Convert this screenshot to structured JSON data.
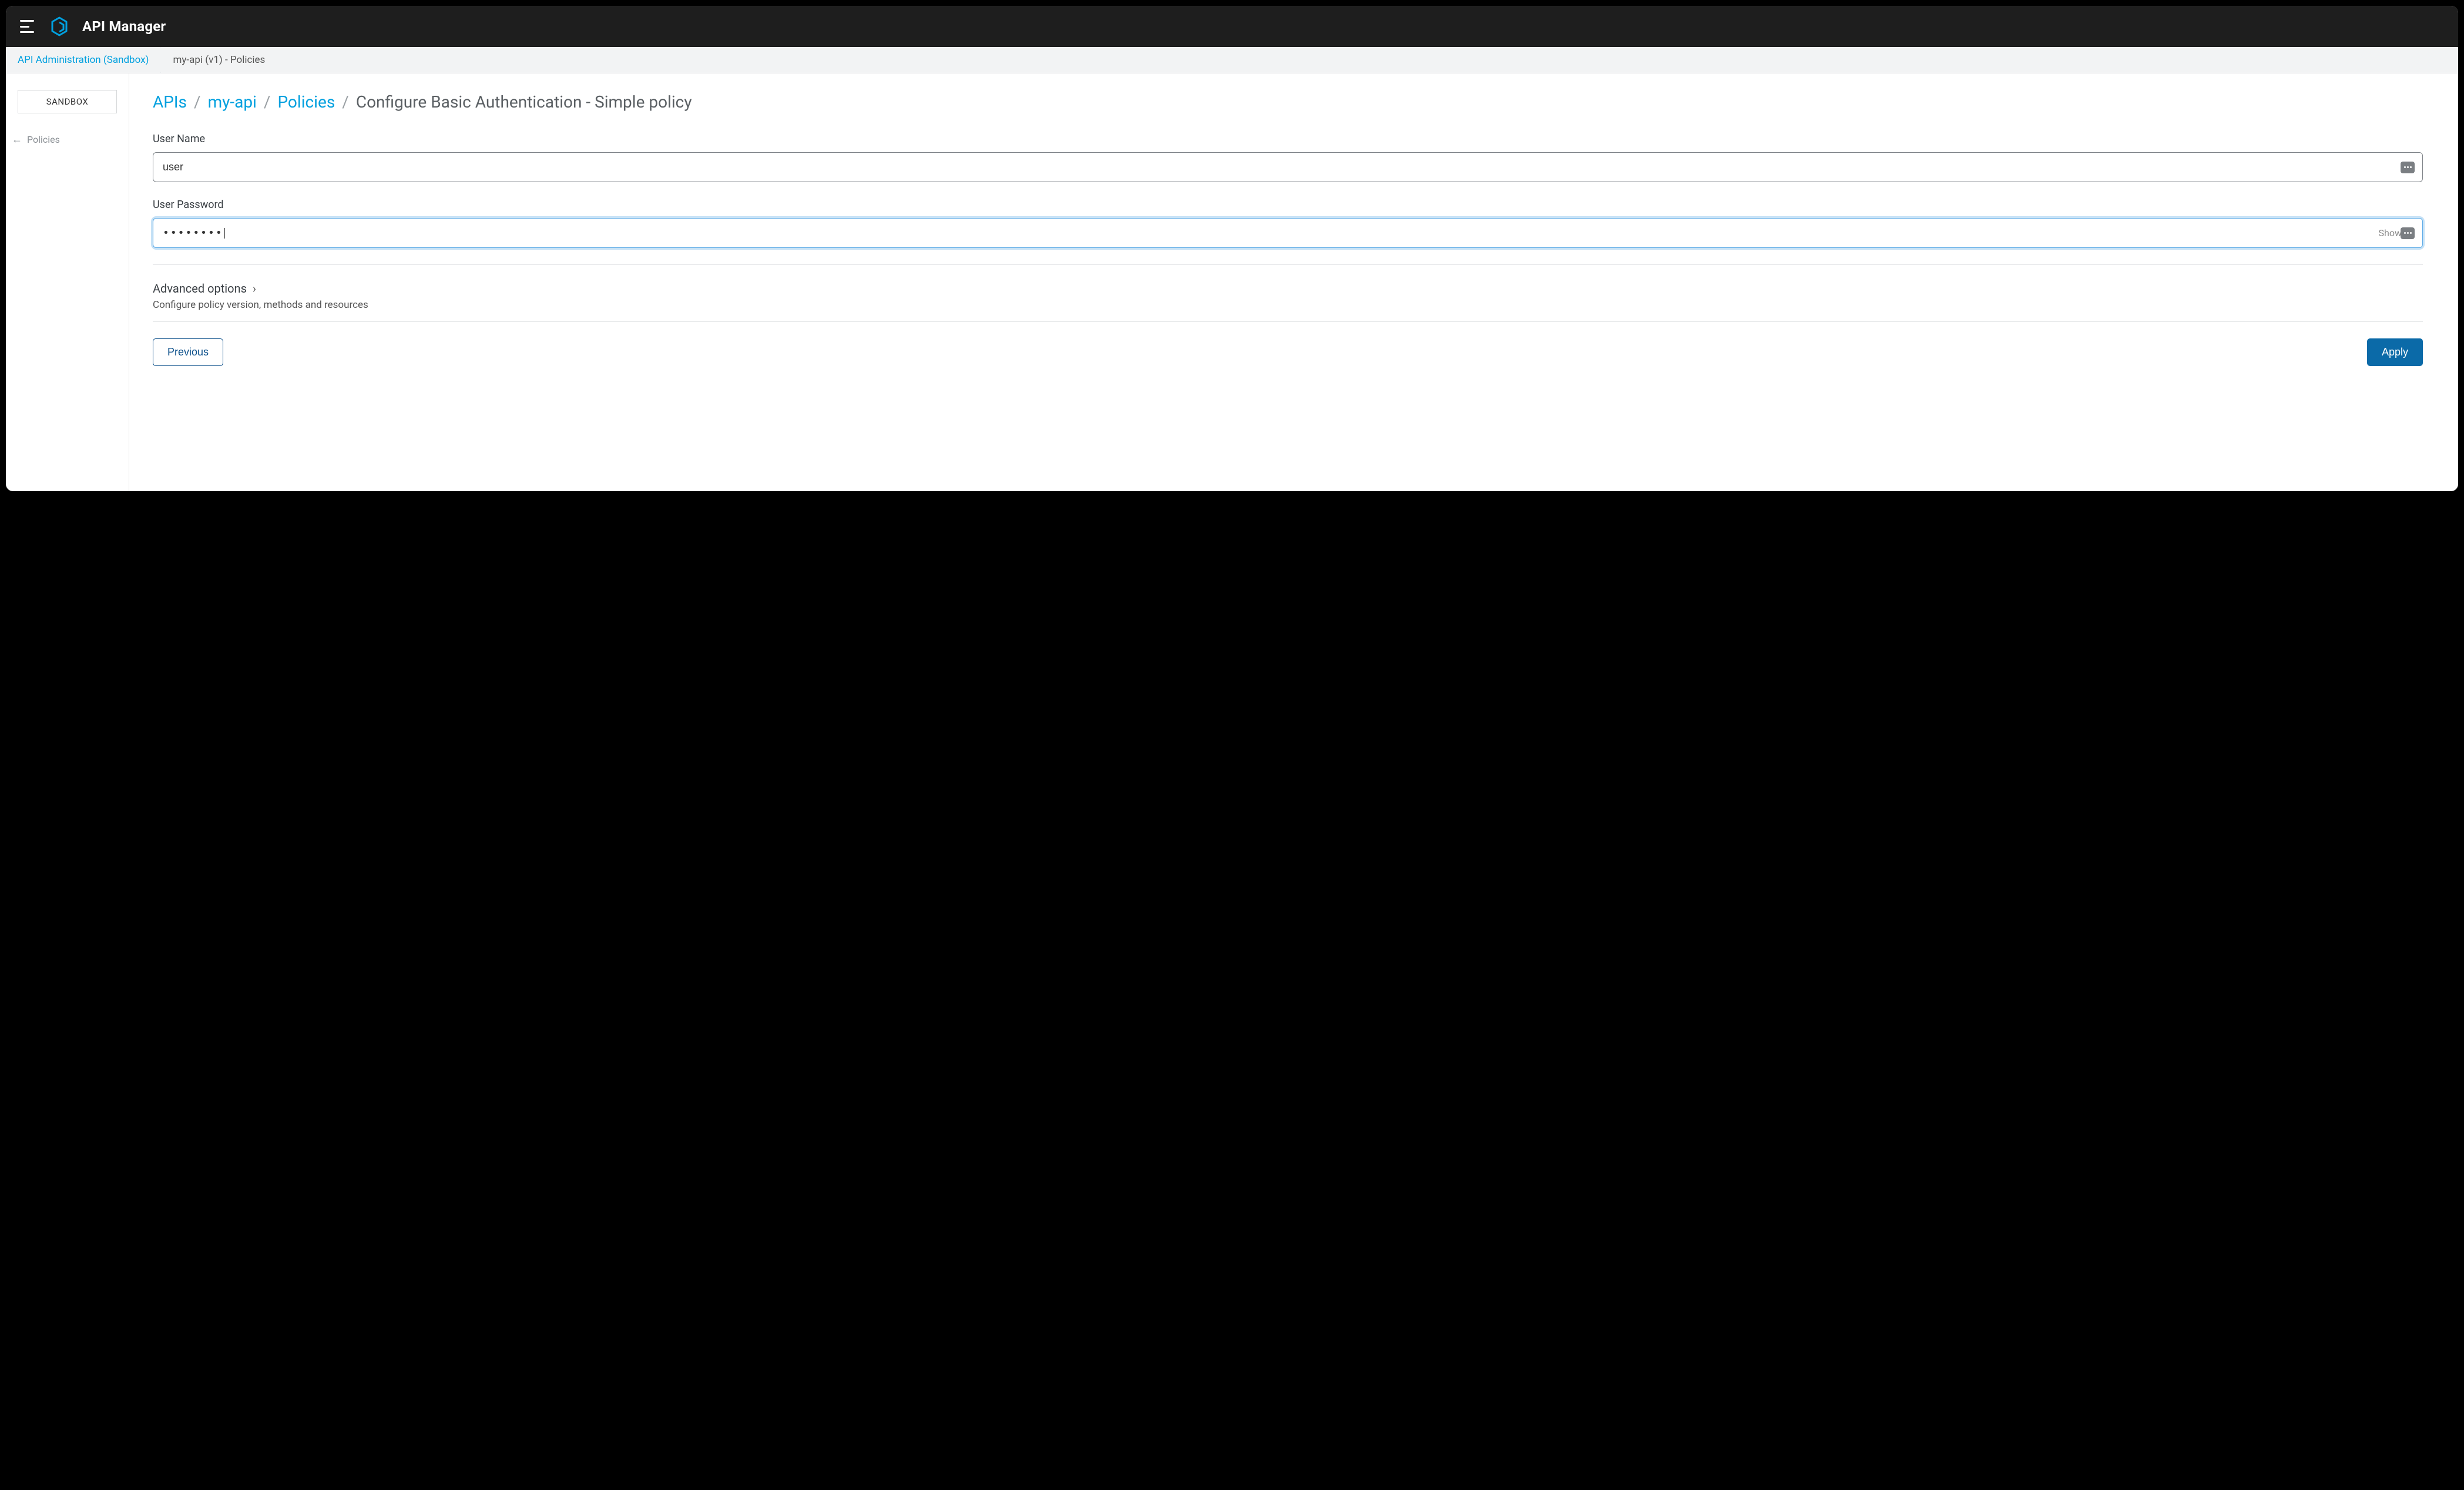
{
  "header": {
    "app_title": "API Manager"
  },
  "breadcrumb_bar": {
    "link_label": "API Administration (Sandbox)",
    "current_label": "my-api (v1) - Policies"
  },
  "sidebar": {
    "badge": "SANDBOX",
    "back_link": "Policies"
  },
  "page_crumb": {
    "seg1": "APIs",
    "seg2": "my-api",
    "seg3": "Policies",
    "current": "Configure Basic Authentication - Simple policy"
  },
  "form": {
    "username_label": "User Name",
    "username_value": "user",
    "password_label": "User Password",
    "password_value": "••••••••",
    "show_label": "Show"
  },
  "advanced": {
    "title": "Advanced options",
    "description": "Configure policy version, methods and resources"
  },
  "buttons": {
    "previous": "Previous",
    "apply": "Apply"
  }
}
